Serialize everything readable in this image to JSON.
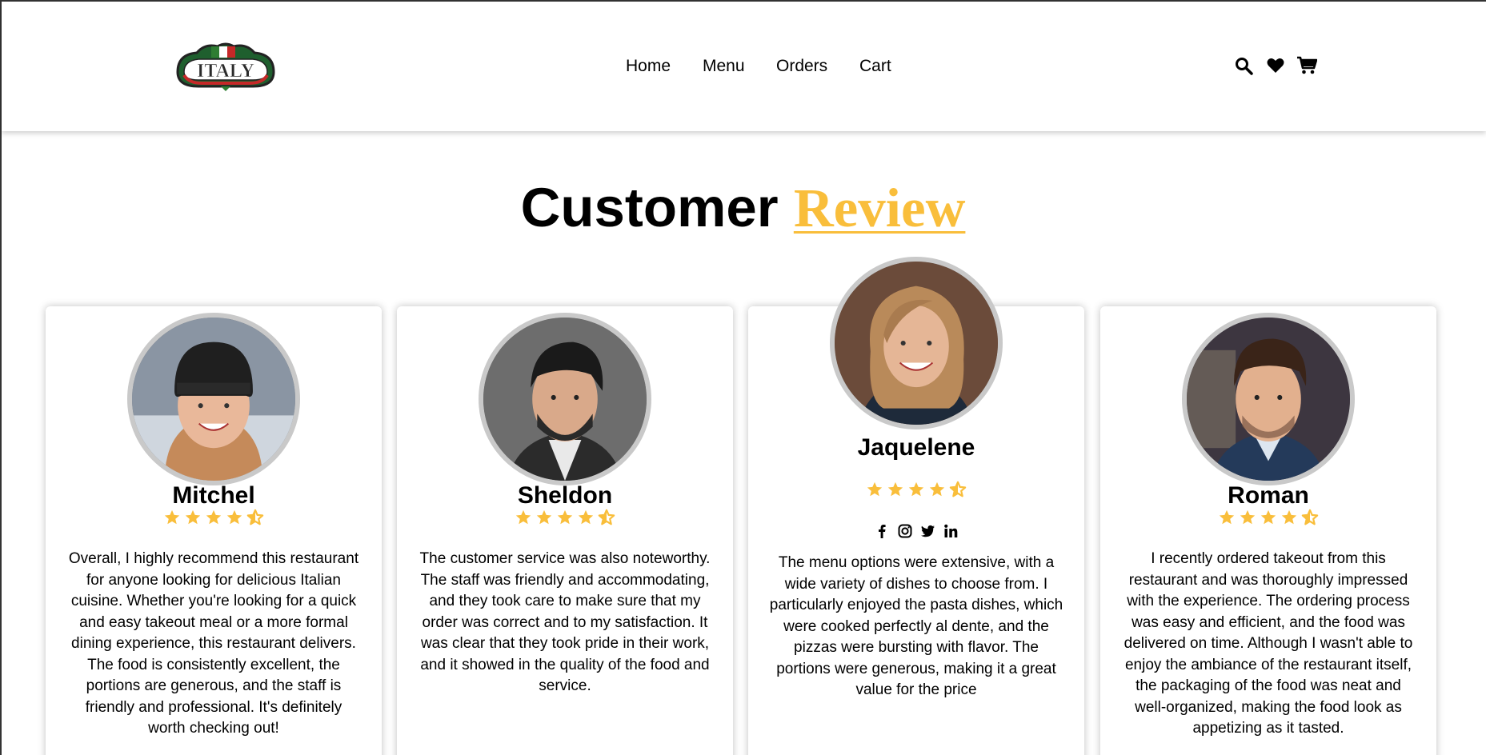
{
  "header": {
    "logo_text": "ITALY",
    "nav": [
      "Home",
      "Menu",
      "Orders",
      "Cart"
    ],
    "icons": [
      "search-icon",
      "heart-icon",
      "cart-icon"
    ]
  },
  "section": {
    "title_main": "Customer",
    "title_accent": "Review",
    "accent_color": "#f9be3b"
  },
  "reviews": [
    {
      "name": "Mitchel",
      "rating": 4.5,
      "text": "Overall, I highly recommend this restaurant for anyone looking for delicious Italian cuisine. Whether you're looking for a quick and easy takeout meal or a more formal dining experience, this restaurant delivers. The food is consistently excellent, the portions are generous, and the staff is friendly and professional. It's definitely worth checking out!"
    },
    {
      "name": "Sheldon",
      "rating": 4.5,
      "text": "The customer service was also noteworthy. The staff was friendly and accommodating, and they took care to make sure that my order was correct and to my satisfaction. It was clear that they took pride in their work, and it showed in the quality of the food and service."
    },
    {
      "name": "Jaquelene",
      "rating": 4.5,
      "socials": [
        "facebook-icon",
        "instagram-icon",
        "twitter-icon",
        "linkedin-icon"
      ],
      "text": "The menu options were extensive, with a wide variety of dishes to choose from. I particularly enjoyed the pasta dishes, which were cooked perfectly al dente, and the pizzas were bursting with flavor. The portions were generous, making it a great value for the price"
    },
    {
      "name": "Roman",
      "rating": 4.5,
      "text": "I recently ordered takeout from this restaurant and was thoroughly impressed with the experience. The ordering process was easy and efficient, and the food was delivered on time. Although I wasn't able to enjoy the ambiance of the restaurant itself, the packaging of the food was neat and well-organized, making the food look as appetizing as it tasted."
    }
  ]
}
